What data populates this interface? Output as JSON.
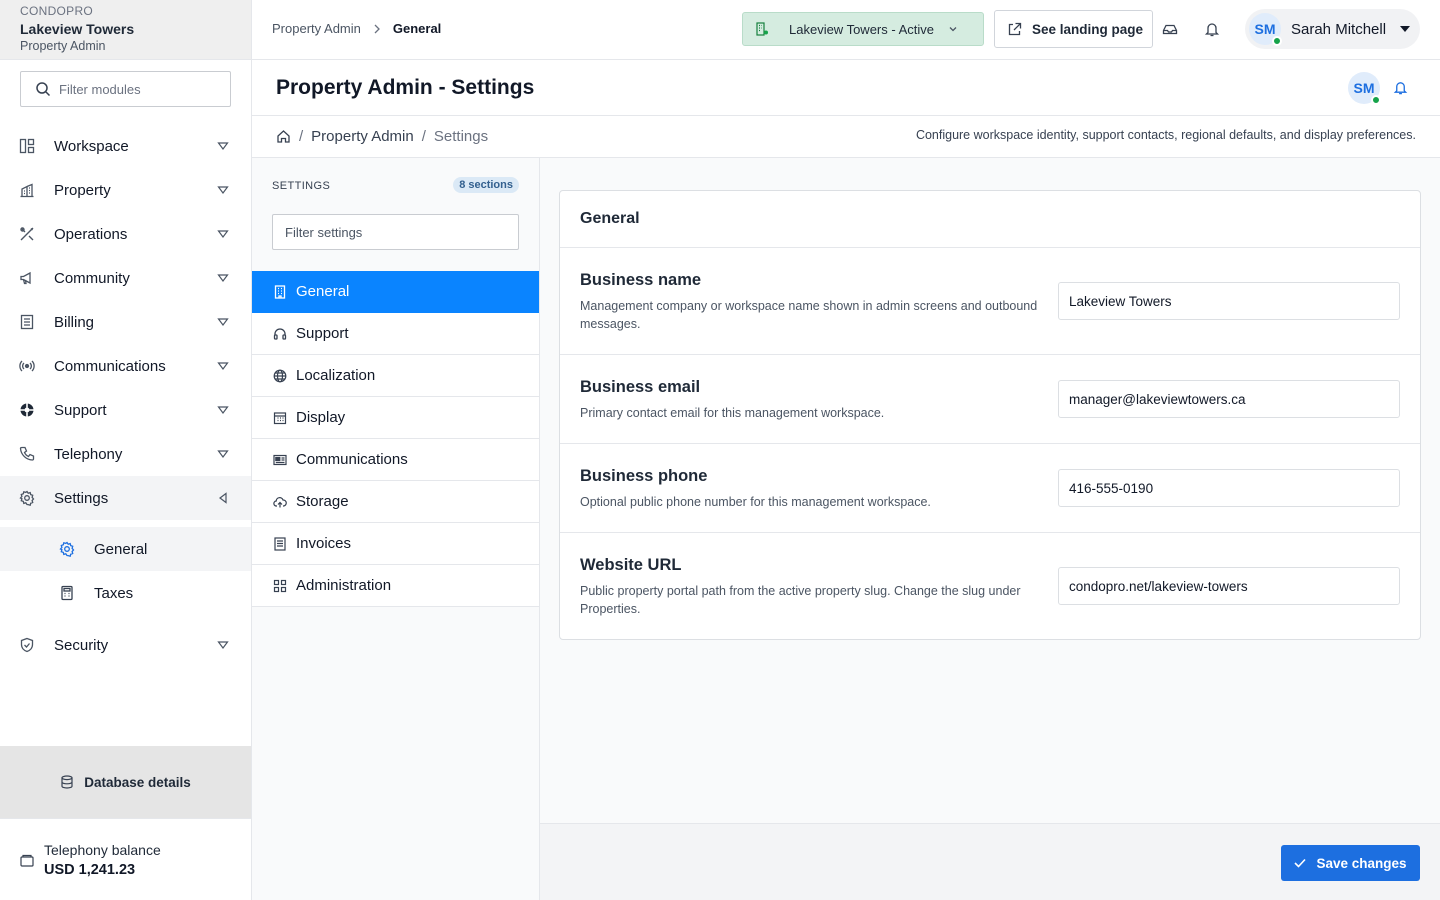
{
  "brand": {
    "app_name": "CONDOPRO",
    "property_name": "Lakeview Towers",
    "role": "Property Admin"
  },
  "nav": {
    "filter_placeholder": "Filter modules",
    "items": [
      {
        "label": "Workspace",
        "icon": "workspace-icon",
        "expanded": false
      },
      {
        "label": "Property",
        "icon": "building-icon",
        "expanded": false
      },
      {
        "label": "Operations",
        "icon": "tools-icon",
        "expanded": false
      },
      {
        "label": "Community",
        "icon": "megaphone-icon",
        "expanded": false
      },
      {
        "label": "Billing",
        "icon": "ledger-icon",
        "expanded": false
      },
      {
        "label": "Communications",
        "icon": "broadcast-icon",
        "expanded": false
      },
      {
        "label": "Support",
        "icon": "lifebuoy-icon",
        "expanded": false
      },
      {
        "label": "Telephony",
        "icon": "phone-icon",
        "expanded": false
      },
      {
        "label": "Settings",
        "icon": "gear-icon",
        "expanded": true
      },
      {
        "label": "Security",
        "icon": "shield-icon",
        "expanded": false
      }
    ],
    "settings_children": [
      {
        "label": "General",
        "icon": "gear-icon",
        "active": true
      },
      {
        "label": "Taxes",
        "icon": "calculator-icon",
        "active": false
      }
    ],
    "database_details_label": "Database details",
    "telephony_balance_label": "Telephony balance",
    "telephony_balance_value": "USD 1,241.23"
  },
  "topbar": {
    "breadcrumb": [
      "Property Admin",
      "General"
    ],
    "property_selector": "Lakeview Towers - Active",
    "landing_button": "See landing page",
    "user": {
      "initials": "SM",
      "name": "Sarah Mitchell"
    }
  },
  "header": {
    "title_strong": "Property Admin -",
    "title_rest": "Settings",
    "breadcrumb": [
      "Property Admin",
      "Settings"
    ],
    "description": "Configure workspace identity, support contacts, regional defaults, and display preferences."
  },
  "settings_nav": {
    "heading": "SETTINGS",
    "count_badge": "8 sections",
    "filter_placeholder": "Filter settings",
    "items": [
      {
        "label": "General",
        "icon": "building-icon",
        "active": true
      },
      {
        "label": "Support",
        "icon": "headset-icon",
        "active": false
      },
      {
        "label": "Localization",
        "icon": "globe-icon",
        "active": false
      },
      {
        "label": "Display",
        "icon": "calendar-grid-icon",
        "active": false
      },
      {
        "label": "Communications",
        "icon": "mail-card-icon",
        "active": false
      },
      {
        "label": "Storage",
        "icon": "cloud-upload-icon",
        "active": false
      },
      {
        "label": "Invoices",
        "icon": "document-icon",
        "active": false
      },
      {
        "label": "Administration",
        "icon": "grid-icon",
        "active": false
      }
    ]
  },
  "general": {
    "title": "General",
    "fields": [
      {
        "label": "Business name",
        "description": "Management company or workspace name shown in admin screens and outbound messages.",
        "value": "Lakeview Towers"
      },
      {
        "label": "Business email",
        "description": "Primary contact email for this management workspace.",
        "value": "manager@lakeviewtowers.ca"
      },
      {
        "label": "Business phone",
        "description": "Optional public phone number for this management workspace.",
        "value": "416-555-0190"
      },
      {
        "label": "Website URL",
        "description": "Public property portal path from the active property slug. Change the slug under Properties.",
        "value": "condopro.net/lakeview-towers"
      }
    ]
  },
  "footer": {
    "save_label": "Save changes"
  },
  "colors": {
    "accent": "#0a84ff",
    "primary_button": "#1d6fe0",
    "active_badge_bg": "#d5ece0",
    "online_dot": "#16a34a"
  }
}
